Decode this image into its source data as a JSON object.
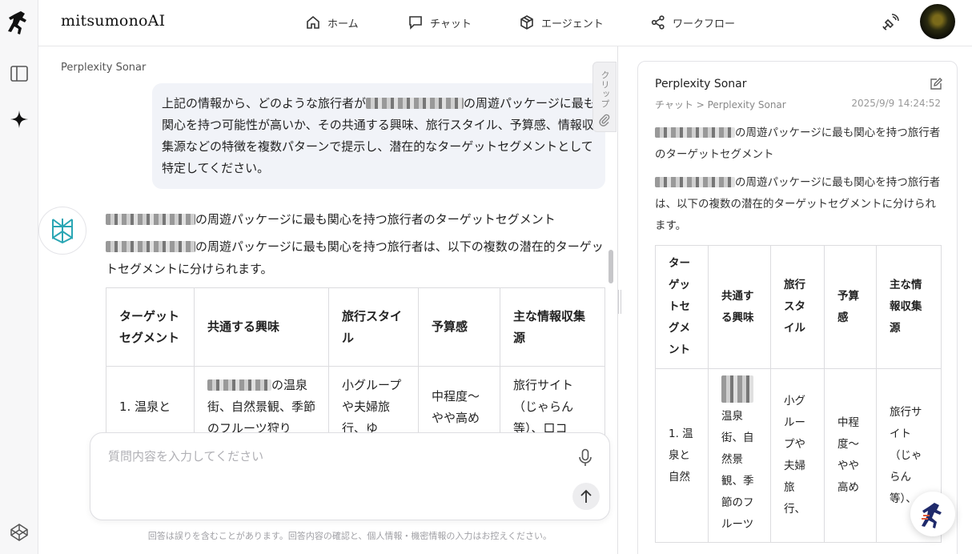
{
  "header": {
    "brand": "mitsumonoAI",
    "nav": [
      {
        "label": "ホーム",
        "icon": "home-icon"
      },
      {
        "label": "チャット",
        "icon": "chat-icon"
      },
      {
        "label": "エージェント",
        "icon": "cube-icon"
      },
      {
        "label": "ワークフロー",
        "icon": "share-nodes-icon"
      }
    ]
  },
  "chat": {
    "model_label": "Perplexity Sonar",
    "clip_label": "クリップ",
    "user_message": {
      "prefix": "上記の情報から、どのような旅行者が",
      "suffix": "の周遊パッケージに最も関心を持つ可能性が高いか、その共通する興味、旅行スタイル、予算感、情報収集源などの特徴を複数パターンで提示し、潜在的なターゲットセグメントとして特定してください。"
    },
    "answer_heading": "の周遊パッケージに最も関心を持つ旅行者のターゲットセグメント",
    "answer_intro": "の周遊パッケージに最も関心を持つ旅行者は、以下の複数の潜在的ターゲットセグメントに分けられます。",
    "table": {
      "headers": [
        "ターゲットセグメント",
        "共通する興味",
        "旅行スタイル",
        "予算感",
        "主な情報収集源"
      ],
      "row1": [
        "1. 温泉と",
        "の温泉街、自然景観、季節のフルーツ狩り",
        "小グループや夫婦旅行、ゆ",
        "中程度〜やや高め",
        "旅行サイト（じゃらん等）、口コ"
      ]
    },
    "input_placeholder": "質問内容を入力してください",
    "disclaimer": "回答は誤りを含むことがあります。回答内容の確認と、個人情報・機密情報の入力はお控えください。"
  },
  "panel": {
    "title": "Perplexity Sonar",
    "breadcrumb": "チャット > Perplexity Sonar",
    "timestamp": "2025/9/9 14:24:52",
    "heading": "の周遊パッケージに最も関心を持つ旅行者のターゲットセグメント",
    "intro": "の周遊パッケージに最も関心を持つ旅行者は、以下の複数の潜在的ターゲットセグメントに分けられます。",
    "table": {
      "headers": [
        "ターゲットセグメント",
        "共通する興味",
        "旅行スタイル",
        "予算感",
        "主な情報収集源"
      ],
      "row1": [
        "1. 温泉と自然",
        "温泉街、自然景観、季節のフルーツ",
        "小グループや夫婦旅行、",
        "中程度〜やや高め",
        "旅行サイト（じゃらん等）、"
      ]
    }
  }
}
